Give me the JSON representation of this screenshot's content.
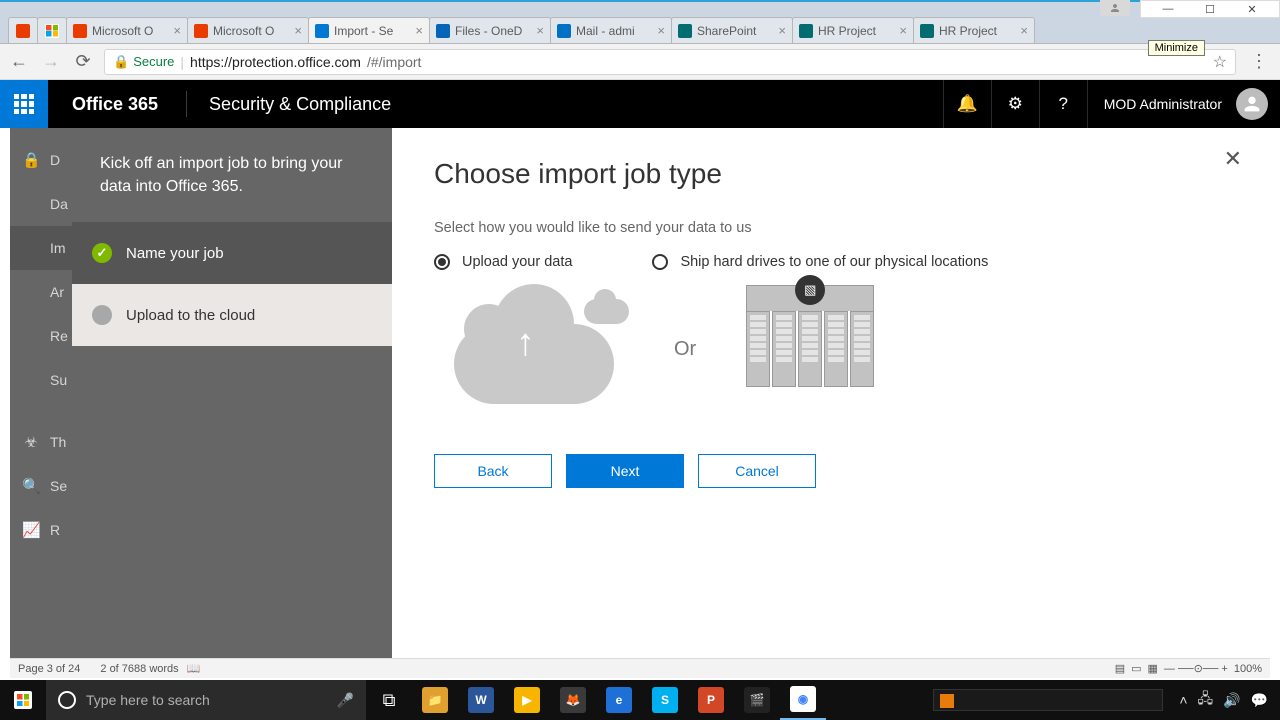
{
  "window": {
    "minimize_tooltip": "Minimize"
  },
  "browser_tabs": [
    {
      "label": "",
      "favicon": "o365"
    },
    {
      "label": "",
      "favicon": "ms"
    },
    {
      "label": "Microsoft O",
      "favicon": "o365",
      "closable": true
    },
    {
      "label": "Microsoft O",
      "favicon": "o365",
      "closable": true
    },
    {
      "label": "Import - Se",
      "favicon": "shield",
      "closable": true,
      "active": true
    },
    {
      "label": "Files - OneD",
      "favicon": "od",
      "closable": true
    },
    {
      "label": "Mail - admi",
      "favicon": "ol",
      "closable": true
    },
    {
      "label": "SharePoint",
      "favicon": "sp",
      "closable": true
    },
    {
      "label": "HR Project",
      "favicon": "sp",
      "closable": true
    },
    {
      "label": "HR Project",
      "favicon": "sp",
      "closable": true
    }
  ],
  "address": {
    "secure_label": "Secure",
    "host": "https://protection.office.com",
    "path": "/#/import"
  },
  "suite": {
    "brand": "Office 365",
    "product": "Security & Compliance",
    "user": "MOD Administrator"
  },
  "leftnav": [
    "D",
    "Da",
    "Im",
    "Ar",
    "Re",
    "Su",
    "Th",
    "Se",
    "R"
  ],
  "wizard": {
    "intro": "Kick off an import job to bring your data into Office 365.",
    "step1": "Name your job",
    "step2": "Upload to the cloud"
  },
  "content": {
    "title": "Choose import job type",
    "subtitle": "Select how you would like to send your data to us",
    "opt_upload": "Upload your data",
    "opt_ship": "Ship hard drives to one of our physical locations",
    "or": "Or",
    "back": "Back",
    "next": "Next",
    "cancel": "Cancel"
  },
  "wordbar": {
    "page": "Page 3 of 24",
    "words": "2 of 7688 words",
    "zoom": "100%"
  },
  "taskbar": {
    "search_placeholder": "Type here to search"
  }
}
